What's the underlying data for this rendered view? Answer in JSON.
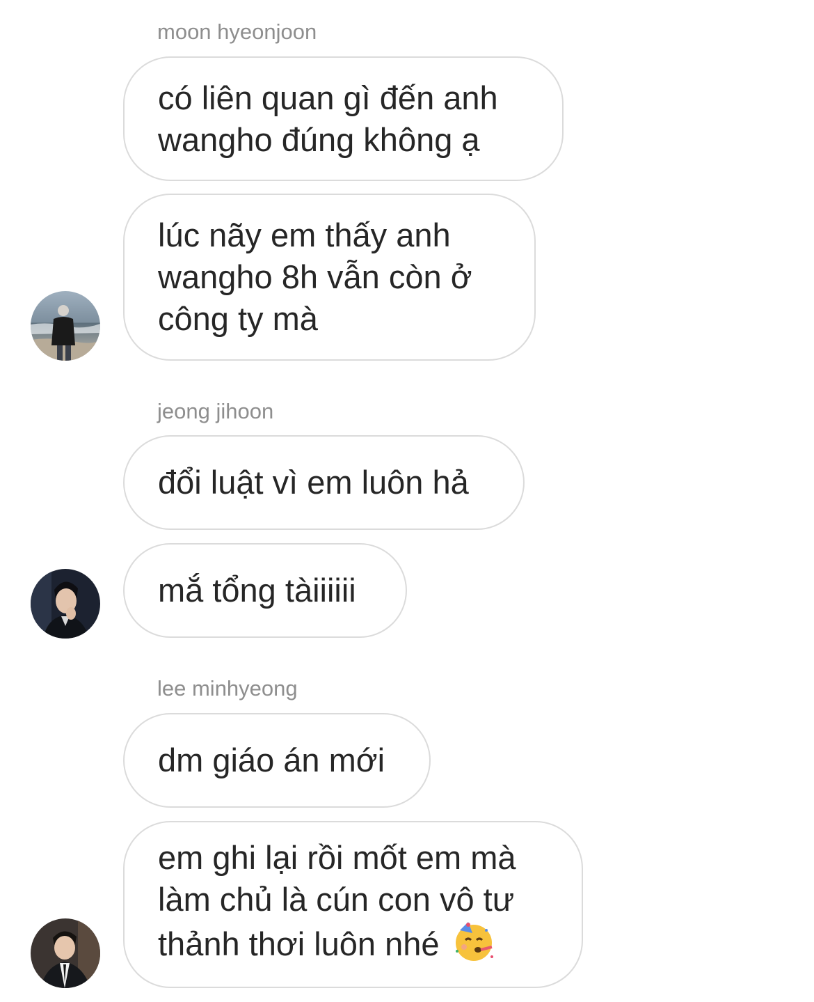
{
  "groups": [
    {
      "sender": "moon hyeonjoon",
      "messages": [
        {
          "lines": [
            "có liên quan gì đến anh",
            "wangho đúng không ạ"
          ]
        },
        {
          "lines": [
            "lúc nãy em thấy anh",
            "wangho 8h vẫn còn ở",
            "công ty mà"
          ]
        }
      ],
      "avatar_icon": "profile-photo-seaside"
    },
    {
      "sender": "jeong jihoon",
      "messages": [
        {
          "lines": [
            "đổi luật vì em luôn hả"
          ]
        },
        {
          "lines": [
            "mắ tổng tàiiiiii"
          ]
        }
      ],
      "avatar_icon": "profile-photo-suit"
    },
    {
      "sender": "lee minhyeong",
      "messages": [
        {
          "lines": [
            "dm giáo án mới"
          ]
        },
        {
          "lines": [
            "em ghi lại rồi mốt em mà",
            "làm chủ là cún con vô tư",
            "thảnh thơi luôn nhé"
          ],
          "emoji": "partying-face-emoji"
        }
      ],
      "avatar_icon": "profile-photo-tuxedo"
    }
  ],
  "colors": {
    "name_text": "#8e8e8e",
    "bubble_border": "#dbdbdb",
    "message_text": "#262626",
    "background": "#ffffff"
  }
}
